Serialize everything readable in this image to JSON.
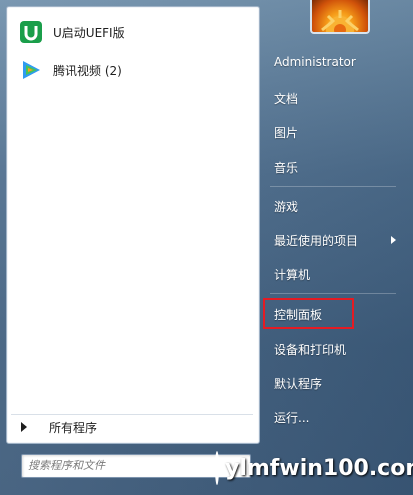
{
  "programs": [
    {
      "label": "U启动UEFI版",
      "icon": "u-boot-icon",
      "color": "#1aa04a"
    },
    {
      "label": "腾讯视频 (2)",
      "icon": "tencent-video-icon",
      "color": "#2f9bf0"
    }
  ],
  "all_programs": {
    "label": "所有程序"
  },
  "search": {
    "placeholder": "搜索程序和文件"
  },
  "right_items": [
    {
      "label": "Administrator"
    },
    {
      "label": "文档"
    },
    {
      "label": "图片"
    },
    {
      "label": "音乐"
    },
    {
      "label": "游戏"
    },
    {
      "label": "最近使用的项目"
    },
    {
      "label": "计算机"
    },
    {
      "label": "控制面板"
    },
    {
      "label": "设备和打印机"
    },
    {
      "label": "默认程序"
    },
    {
      "label": "运行..."
    }
  ],
  "highlight_color": "#e41b23",
  "watermark": {
    "text": "ylmfwin100.com"
  }
}
